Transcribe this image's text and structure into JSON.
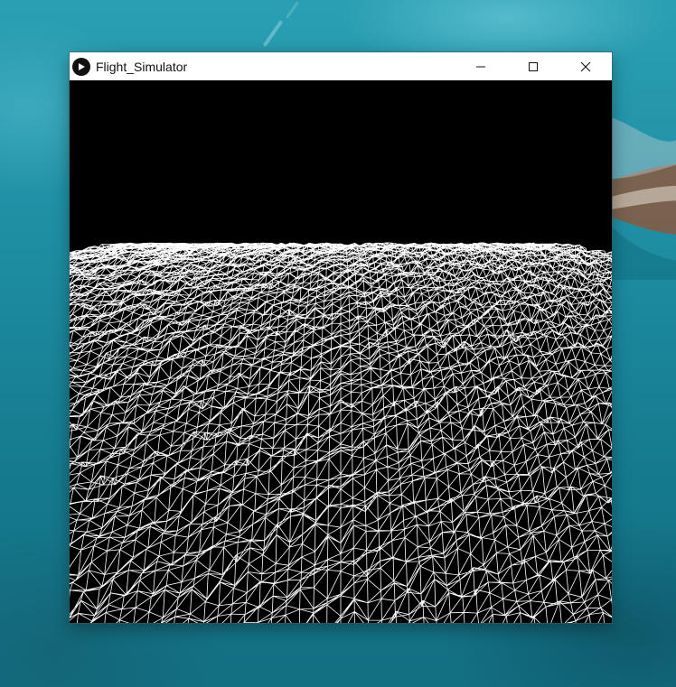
{
  "window": {
    "title": "Flight_Simulator"
  },
  "icons": {
    "app": "processing-play-icon",
    "minimize": "minimize-icon",
    "maximize": "maximize-icon",
    "close": "close-icon"
  },
  "colors": {
    "titlebar_bg": "#ffffff",
    "canvas_bg": "#000000",
    "terrain_stroke": "#ffffff",
    "desktop_water": "#1f8ea3"
  }
}
